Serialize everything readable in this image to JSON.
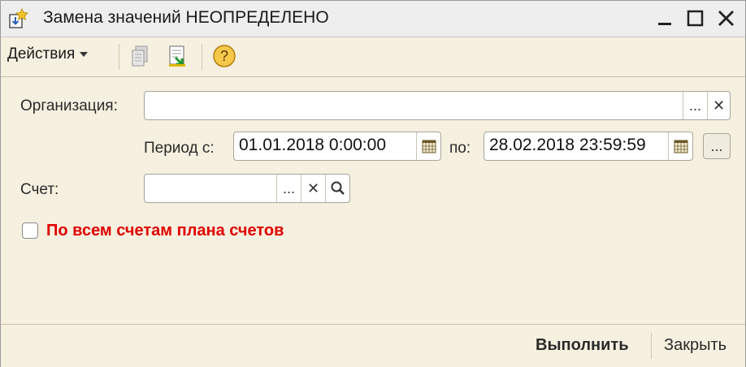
{
  "window": {
    "title": "Замена значений НЕОПРЕДЕЛЕНО"
  },
  "toolbar": {
    "actions_label": "Действия"
  },
  "form": {
    "organization_label": "Организация:",
    "organization_value": "",
    "period_from_label": "Период с:",
    "period_from_value": "01.01.2018  0:00:00",
    "period_to_label": "по:",
    "period_to_value": "28.02.2018 23:59:59",
    "account_label": "Счет:",
    "account_value": "",
    "all_accounts_label": "По всем счетам плана счетов",
    "all_accounts_checked": false,
    "select_glyph": "...",
    "clear_glyph": "✕"
  },
  "footer": {
    "execute_label": "Выполнить",
    "close_label": "Закрыть"
  },
  "colors": {
    "background": "#f5f0df",
    "checkbox_label": "#e00000"
  }
}
